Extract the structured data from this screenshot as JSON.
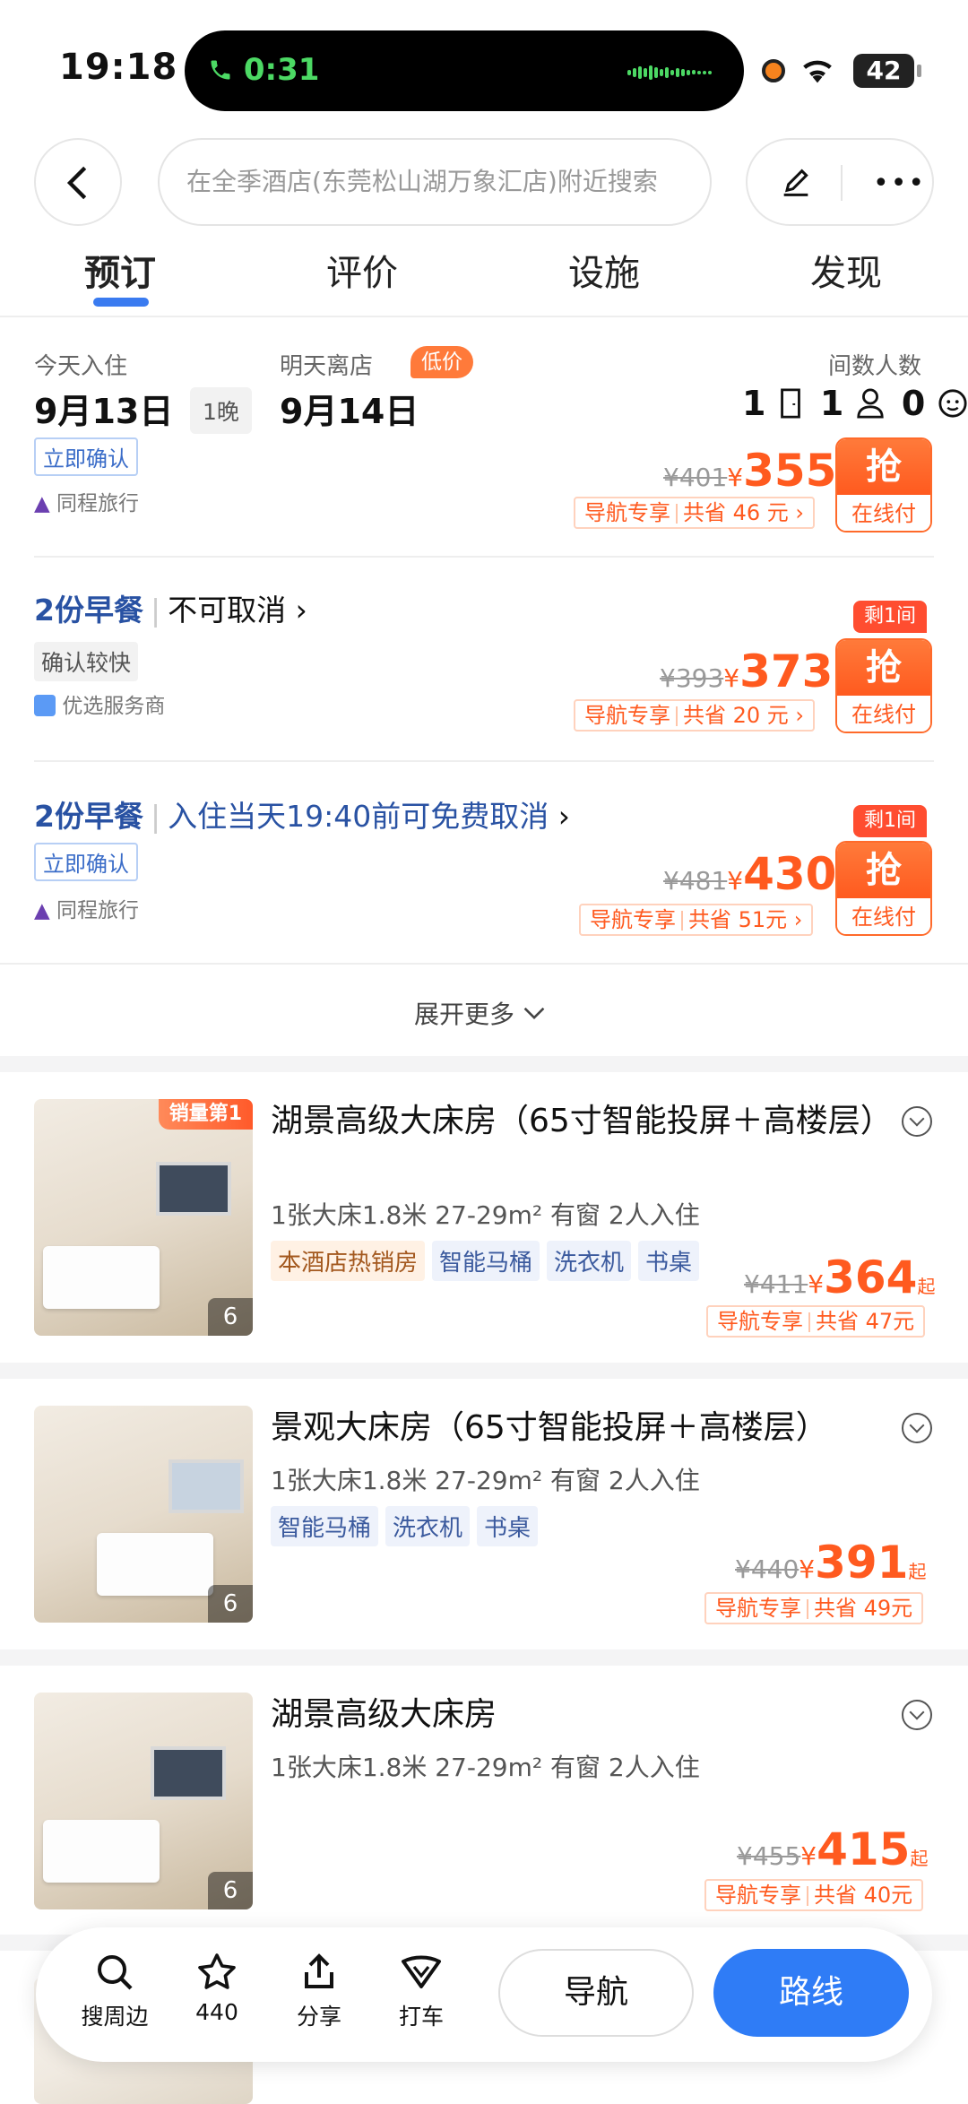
{
  "status_bar": {
    "time": "19:18",
    "call_timer": "0:31",
    "battery": "42"
  },
  "header": {
    "search_placeholder": "在全季酒店(东莞松山湖万象汇店)附近搜索"
  },
  "tabs": [
    {
      "label": "预订"
    },
    {
      "label": "评价"
    },
    {
      "label": "设施"
    },
    {
      "label": "发现"
    }
  ],
  "booking": {
    "checkin_label": "今天入住",
    "checkin_date": "9月13日",
    "nights": "1晚",
    "checkout_label": "明天离店",
    "checkout_date": "9月14日",
    "low_price_badge": "低价",
    "rooms_people_label": "间数人数",
    "rooms": "1",
    "adults": "1",
    "children": "0"
  },
  "offers": [
    {
      "chip": "立即确认",
      "provider": "同程旅行",
      "old_price": "¥401",
      "yen": "¥",
      "price": "355",
      "promo_a": "导航专享",
      "promo_b": "共省 46 元",
      "grab": "抢",
      "pay": "在线付"
    },
    {
      "meal": "2份早餐",
      "policy": "不可取消",
      "chip": "确认较快",
      "provider": "优选服务商",
      "left_tag": "剩1间",
      "old_price": "¥393",
      "yen": "¥",
      "price": "373",
      "promo_a": "导航专享",
      "promo_b": "共省 20 元",
      "grab": "抢",
      "pay": "在线付"
    },
    {
      "meal": "2份早餐",
      "policy": "入住当天19:40前可免费取消",
      "chip": "立即确认",
      "provider": "同程旅行",
      "left_tag": "剩1间",
      "old_price": "¥481",
      "yen": "¥",
      "price": "430",
      "promo_a": "导航专享",
      "promo_b": "共省 51元",
      "grab": "抢",
      "pay": "在线付"
    }
  ],
  "expand_more": "展开更多",
  "rooms": [
    {
      "badge": "销量第1",
      "title": "湖景高级大床房（65寸智能投屏＋高楼层）",
      "spec": "1张大床1.8米   27-29m²   有窗   2人入住",
      "tags": [
        "本酒店热销房",
        "智能马桶",
        "洗衣机",
        "书桌"
      ],
      "photo_count": "6",
      "old_price": "¥411",
      "yen": "¥",
      "price": "364",
      "qi": "起",
      "promo_a": "导航专享",
      "promo_b": "共省 47元"
    },
    {
      "title": "景观大床房（65寸智能投屏＋高楼层）",
      "spec": "1张大床1.8米   27-29m²   有窗   2人入住",
      "tags": [
        "智能马桶",
        "洗衣机",
        "书桌"
      ],
      "photo_count": "6",
      "old_price": "¥440",
      "yen": "¥",
      "price": "391",
      "qi": "起",
      "promo_a": "导航专享",
      "promo_b": "共省 49元"
    },
    {
      "title": "湖景高级大床房",
      "spec": "1张大床1.8米   27-29m²   有窗   2人入住",
      "photo_count": "6",
      "old_price": "¥455",
      "yen": "¥",
      "price": "415",
      "qi": "起",
      "promo_a": "导航专享",
      "promo_b": "共省 40元"
    }
  ],
  "bottom_bar": {
    "search_nearby": "搜周边",
    "favorites": "440",
    "share": "分享",
    "taxi": "打车",
    "navigate": "导航",
    "route": "路线"
  },
  "colors": {
    "accent_orange": "#ff5a1f",
    "route_blue": "#2f7cf6",
    "link_blue": "#2952a3"
  }
}
